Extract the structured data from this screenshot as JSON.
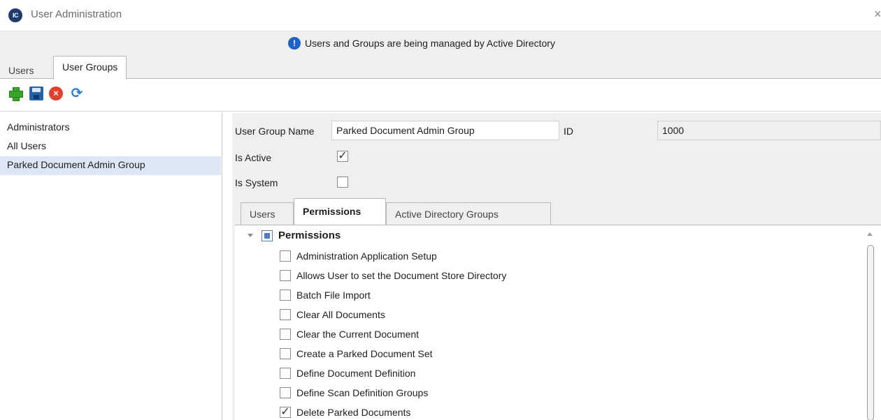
{
  "window": {
    "title": "User Administration",
    "app_icon_text": "IC",
    "close_glyph": "×"
  },
  "banner": {
    "message": "Users and Groups are being managed by Active Directory"
  },
  "top_tabs": [
    {
      "label": "Users",
      "active": false
    },
    {
      "label": "User Groups",
      "active": true
    }
  ],
  "toolbar": {
    "icons": [
      "add-icon",
      "save-icon",
      "cancel-icon",
      "refresh-icon"
    ]
  },
  "groups": [
    {
      "name": "Administrators",
      "selected": false
    },
    {
      "name": "All Users",
      "selected": false
    },
    {
      "name": "Parked Document Admin Group",
      "selected": true
    }
  ],
  "detail": {
    "group_name_label": "User Group Name",
    "group_name_value": "Parked Document Admin Group",
    "id_label": "ID",
    "id_value": "1000",
    "is_active_label": "Is Active",
    "is_active_checked": true,
    "is_system_label": "Is System",
    "is_system_checked": false
  },
  "inner_tabs": [
    {
      "label": "Users",
      "active": false
    },
    {
      "label": "Permissions",
      "active": true
    },
    {
      "label": "Active Directory Groups",
      "active": false
    }
  ],
  "permissions": {
    "root_label": "Permissions",
    "items": [
      {
        "label": "Administration Application Setup",
        "checked": false
      },
      {
        "label": "Allows User to set the Document Store Directory",
        "checked": false
      },
      {
        "label": "Batch File Import",
        "checked": false
      },
      {
        "label": "Clear All Documents",
        "checked": false
      },
      {
        "label": "Clear the Current Document",
        "checked": false
      },
      {
        "label": "Create a Parked Document Set",
        "checked": false
      },
      {
        "label": "Define Document Definition",
        "checked": false
      },
      {
        "label": "Define Scan Definition Groups",
        "checked": false
      },
      {
        "label": "Delete Parked Documents",
        "checked": true
      }
    ]
  },
  "colors": {
    "accent": "#1e62c9",
    "selection": "#dde6f4",
    "panel": "#efefef"
  }
}
